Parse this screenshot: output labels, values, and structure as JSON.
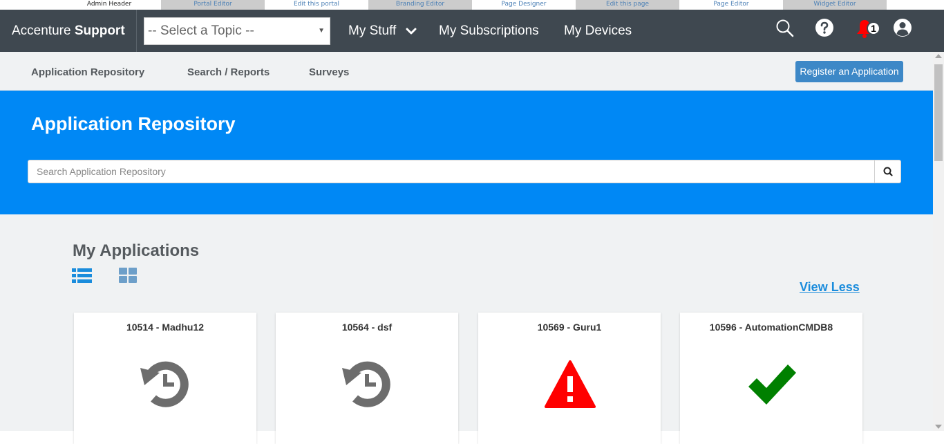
{
  "admin_tabs": [
    "Admin Header",
    "Portal Editor",
    "Edit this portal",
    "Branding Editor",
    "Page Designer",
    "Edit this page",
    "Page Editor",
    "Widget Editor"
  ],
  "topbar": {
    "brand_prefix": "Accenture",
    "brand_bold": "Support",
    "topic_select": "-- Select a Topic --",
    "nav": [
      "My Stuff",
      "My Subscriptions",
      "My Devices"
    ],
    "notification_count": "1",
    "icons": [
      "search-icon",
      "help-icon",
      "bell-icon",
      "user-icon"
    ]
  },
  "subnav": {
    "links": [
      "Application Repository",
      "Search / Reports",
      "Surveys"
    ],
    "register_button": "Register an Application"
  },
  "hero": {
    "title": "Application Repository",
    "search_placeholder": "Search Application Repository"
  },
  "main": {
    "section_title": "My Applications",
    "view_less": "View Less",
    "cards": [
      {
        "title": "10514 - Madhu12",
        "icon": "history-icon"
      },
      {
        "title": "10564 - dsf",
        "icon": "history-icon"
      },
      {
        "title": "10569 - Guru1",
        "icon": "warning-icon"
      },
      {
        "title": "10596 - AutomationCMDB8",
        "icon": "check-icon"
      }
    ]
  },
  "colors": {
    "topbar": "#3f4850",
    "hero": "#0088f5",
    "accent_button": "#3d88c7",
    "link": "#1a8cdc",
    "warning": "#ff0000",
    "success": "#008000",
    "history": "#6d6d6d"
  }
}
